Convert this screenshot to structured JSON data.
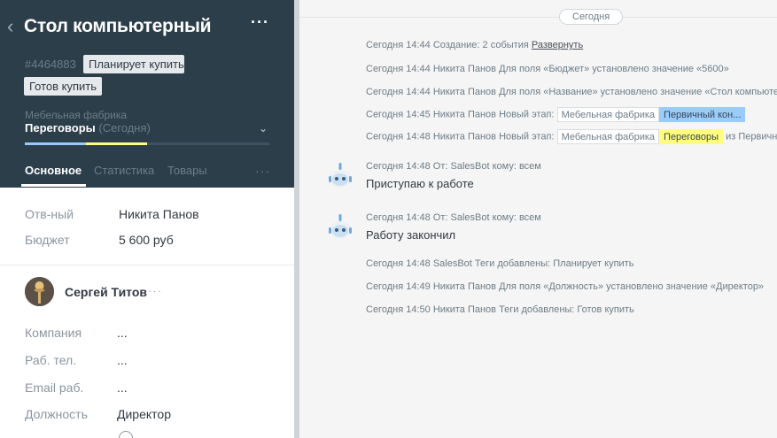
{
  "lead": {
    "title": "Стол компьютерный",
    "back_icon": "chevron-left-icon",
    "menu_icon": "ellipsis-icon",
    "id": "#4464883",
    "tags": [
      "Планирует купить",
      "Готов купить"
    ],
    "pipeline": "Мебельная фабрика",
    "stage": "Переговоры",
    "stage_date": "(Сегодня)",
    "progress": 0.5,
    "stage_colors": [
      "#99ccfd",
      "#fffd7f"
    ],
    "tabs": [
      "Основное",
      "Статистика",
      "Товары"
    ],
    "tabs_more": "···"
  },
  "fields": [
    {
      "label": "Отв-ный",
      "value": "Никита Панов"
    },
    {
      "label": "Бюджет",
      "value": "5 600 руб"
    }
  ],
  "contact": {
    "name": "Сергей Титов",
    "more": "···",
    "fields": [
      {
        "label": "Компания",
        "value": "..."
      },
      {
        "label": "Раб. тел.",
        "value": "..."
      },
      {
        "label": "Email раб.",
        "value": "..."
      },
      {
        "label": "Должность",
        "value": "Директор"
      }
    ]
  },
  "feed": {
    "day_label": "Сегодня",
    "events": [
      {
        "time": "Сегодня 14:44",
        "text": "Создание: 2 события",
        "link": "Развернуть"
      },
      {
        "time": "Сегодня 14:44",
        "text": "Никита Панов  Для поля «Бюджет» установлено значение «5600»"
      },
      {
        "time": "Сегодня 14:44",
        "text": "Никита Панов  Для поля «Название» установлено значение «Стол компьютерный»"
      },
      {
        "time": "Сегодня 14:45",
        "text": "Никита Панов  Новый этап:",
        "chips": [
          "Мебельная фабрика",
          "Первичный кон..."
        ]
      },
      {
        "time": "Сегодня 14:48",
        "text": "Никита Панов  Новый этап:",
        "chips": [
          "Мебельная фабрика",
          "Переговоры"
        ],
        "suffix": "из Первичный контакт"
      }
    ],
    "messages": [
      {
        "meta": "Сегодня 14:48 От: SalesBot кому: всем",
        "text": "Приступаю к работе"
      },
      {
        "meta": "Сегодня 14:48 От: SalesBot кому: всем",
        "text": "Работу закончил"
      }
    ],
    "events2": [
      {
        "time": "Сегодня 14:48",
        "text": "SalesBot  Теги добавлены: Планирует купить"
      },
      {
        "time": "Сегодня 14:49",
        "text": "Никита Панов  Для поля «Должность» установлено значение «Директор»"
      },
      {
        "time": "Сегодня 14:50",
        "text": "Никита Панов  Теги добавлены: Готов купить"
      }
    ]
  }
}
